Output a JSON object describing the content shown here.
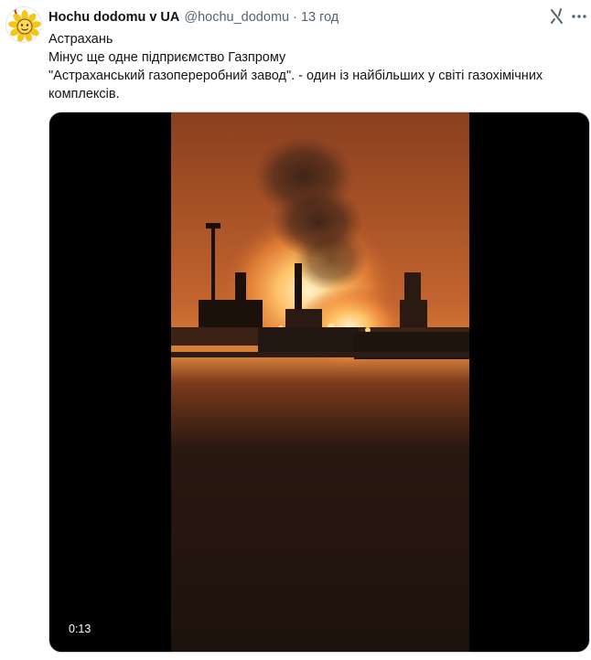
{
  "tweet": {
    "author": {
      "display_name": "Hochu dodomu v UA",
      "handle": "@hochu_dodomu",
      "separator": "·",
      "time": "13 год",
      "avatar_icon": "sunflower-avatar-icon"
    },
    "text_lines": [
      "Астрахань",
      "Мінус ще одне підприємство Газпрому",
      "\"Астраханський газопереробний завод\". - один із найбільших у світі газохімічних",
      "комплексів."
    ],
    "media": {
      "type": "video",
      "duration": "0:13",
      "background": "#000000"
    },
    "actions": {
      "grok_icon": "grok-icon",
      "more_icon": "more-options-icon"
    },
    "colors": {
      "text": "#0f1419",
      "secondary_text": "#536471",
      "fire_glow": "#ffb050",
      "sky_orange": "#b85a2c"
    }
  }
}
